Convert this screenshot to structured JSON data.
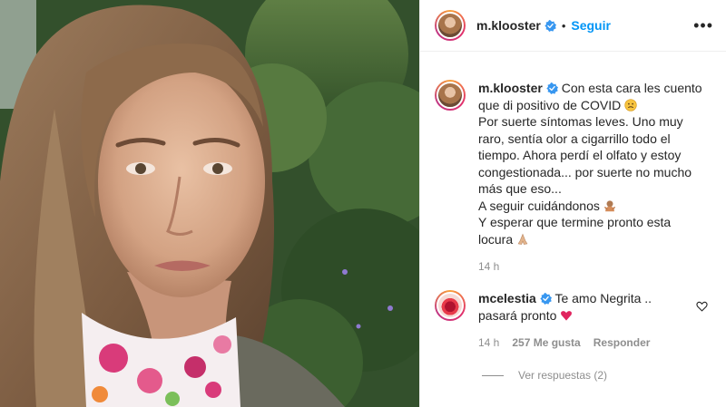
{
  "header": {
    "username": "m.klooster",
    "separator": "•",
    "follow_label": "Seguir",
    "more_label": "•••"
  },
  "caption": {
    "username": "m.klooster",
    "lines": [
      "Con esta cara les cuento",
      "que di positivo de COVID",
      "Por suerte síntomas leves. Uno muy",
      "raro, sentía olor a cigarrillo todo el",
      "tiempo. Ahora perdí el olfato y estoy",
      "congestionada... por suerte no mucho",
      "más que eso...",
      "A seguir cuidándonos",
      "Y esperar que termine pronto esta",
      "locura"
    ],
    "time": "14 h"
  },
  "comments": [
    {
      "username": "mcelestia",
      "text_line1": "Te amo Negrita ..",
      "text_line2": "pasará pronto",
      "time": "14 h",
      "likes": "257 Me gusta",
      "reply_label": "Responder",
      "view_replies": "Ver respuestas (2)"
    }
  ],
  "icons": {
    "verified": "verified-badge-icon",
    "more": "more-options-icon",
    "like": "heart-outline-icon",
    "sad_emoji": "sad-face-emoji",
    "hug_emoji": "hugging-person-emoji",
    "pray_emoji": "folded-hands-emoji",
    "heart_emoji": "red-heart-emoji"
  },
  "colors": {
    "accent": "#0095f6",
    "text": "#262626",
    "muted": "#8e8e8e",
    "heart": "#e0245e"
  }
}
